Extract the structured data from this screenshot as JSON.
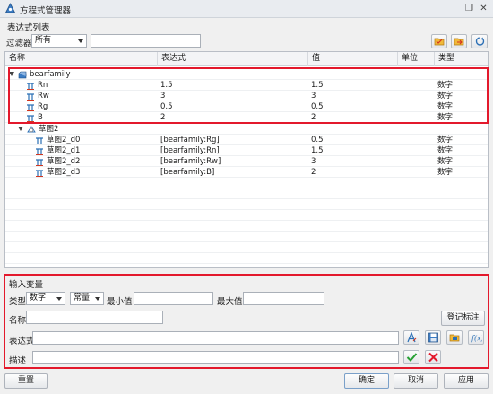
{
  "window": {
    "title": "方程式管理器"
  },
  "list_group": {
    "label": "表达式列表"
  },
  "filter": {
    "label": "过滤器",
    "selected": "所有",
    "search_value": ""
  },
  "table": {
    "headers": [
      "名称",
      "表达式",
      "值",
      "单位",
      "类型"
    ],
    "groups": [
      {
        "name": "bearfamily",
        "rows": [
          {
            "name": "Rn",
            "expr": "1.5",
            "value": "1.5",
            "unit": "",
            "type": "数字"
          },
          {
            "name": "Rw",
            "expr": "3",
            "value": "3",
            "unit": "",
            "type": "数字"
          },
          {
            "name": "Rg",
            "expr": "0.5",
            "value": "0.5",
            "unit": "",
            "type": "数字"
          },
          {
            "name": "B",
            "expr": "2",
            "value": "2",
            "unit": "",
            "type": "数字"
          }
        ]
      },
      {
        "name": "草图2",
        "rows": [
          {
            "name": "草图2_d0",
            "expr": "[bearfamily:Rg]",
            "value": "0.5",
            "unit": "",
            "type": "数字"
          },
          {
            "name": "草图2_d1",
            "expr": "[bearfamily:Rn]",
            "value": "1.5",
            "unit": "",
            "type": "数字"
          },
          {
            "name": "草图2_d2",
            "expr": "[bearfamily:Rw]",
            "value": "3",
            "unit": "",
            "type": "数字"
          },
          {
            "name": "草图2_d3",
            "expr": "[bearfamily:B]",
            "value": "2",
            "unit": "",
            "type": "数字"
          }
        ]
      }
    ]
  },
  "input": {
    "group_label": "输入变量",
    "type_label": "类型",
    "type_selected": "数字",
    "kind_selected": "常量",
    "min_label": "最小值",
    "min_value": "",
    "max_label": "最大值",
    "max_value": "",
    "name_label": "名称",
    "name_value": "",
    "register_label": "登记标注",
    "expr_label": "表达式",
    "expr_value": "",
    "desc_label": "描述",
    "desc_value": ""
  },
  "footer": {
    "reset": "重置",
    "ok": "确定",
    "cancel": "取消",
    "apply": "应用"
  },
  "icons": {
    "app": "equation-manager-icon",
    "folder_open": "folder-open-icon",
    "folder_export": "folder-export-icon",
    "refresh": "refresh-icon",
    "part": "part-icon",
    "sketch": "sketch-icon",
    "variable": "variable-pi-icon"
  },
  "colors": {
    "highlight": "#e3192c",
    "accent": "#2a6fb5"
  }
}
